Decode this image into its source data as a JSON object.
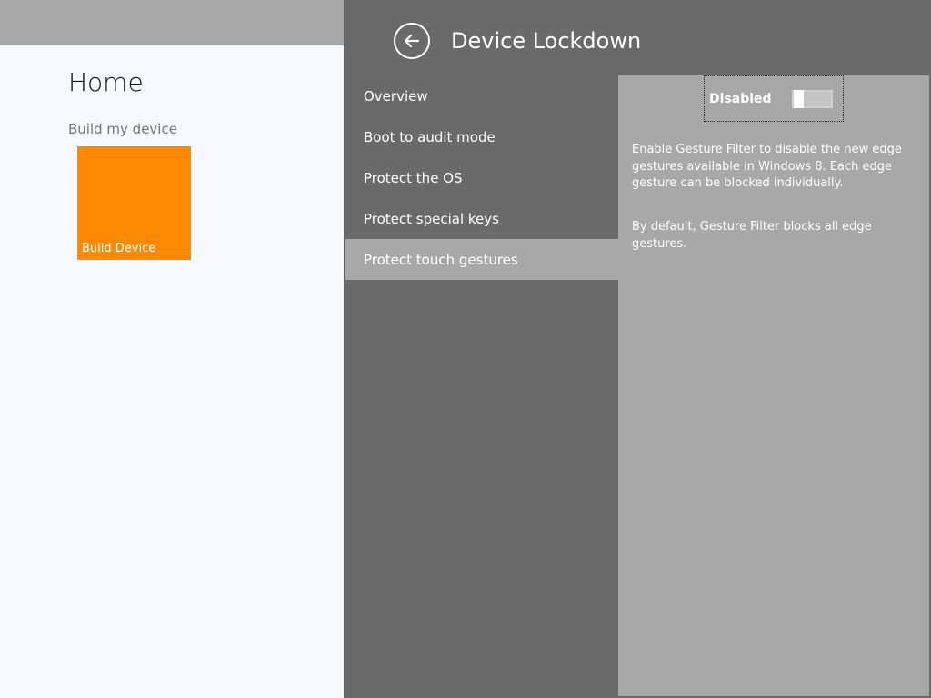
{
  "home": {
    "title": "Home",
    "group_label": "Build my device",
    "tile": {
      "label": "Build Device",
      "color": "#ff8a00"
    }
  },
  "flyout": {
    "title": "Device Lockdown",
    "back_icon": "back-arrow-icon",
    "nav": [
      {
        "label": "Overview",
        "selected": false
      },
      {
        "label": "Boot to audit mode",
        "selected": false
      },
      {
        "label": "Protect the OS",
        "selected": false
      },
      {
        "label": "Protect special keys",
        "selected": false
      },
      {
        "label": "Protect touch gestures",
        "selected": true
      }
    ],
    "content": {
      "toggle": {
        "label": "Disabled",
        "on": false
      },
      "description": "Enable Gesture Filter to disable the new edge gestures available in Windows 8. Each edge gesture can be blocked individually.",
      "default_note": "By default, Gesture Filter blocks all edge gestures."
    }
  },
  "colors": {
    "flyout_bg": "#6a6a6a",
    "panel_bg": "#a8a8a8",
    "home_bg": "#f7f8fd"
  }
}
